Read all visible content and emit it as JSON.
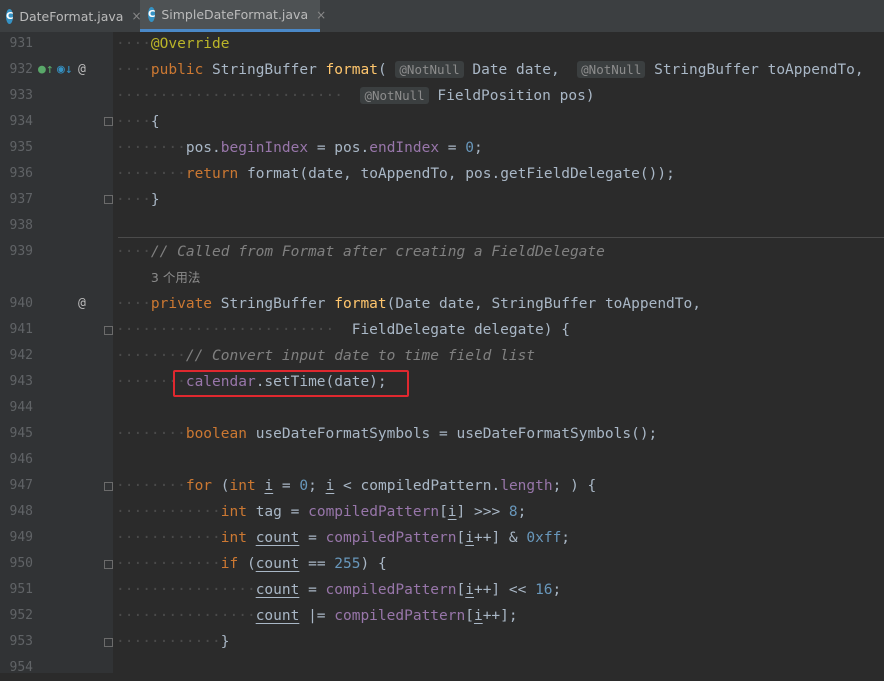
{
  "tabs": [
    {
      "label": "DateFormat.java",
      "active": false
    },
    {
      "label": "SimpleDateFormat.java",
      "active": true
    }
  ],
  "tab_icon_letter": "C",
  "tab_close": "×",
  "gutter_icons": {
    "override_up": "●↑",
    "impl_down": "◉↓",
    "at": "@"
  },
  "hints": {
    "notnull": "@NotNull"
  },
  "usages_label": "3 个用法",
  "lines": {
    "931": "931",
    "932": "932",
    "933": "933",
    "934": "934",
    "935": "935",
    "936": "936",
    "937": "937",
    "938": "938",
    "939": "939",
    "940": "940",
    "941": "941",
    "942": "942",
    "943": "943",
    "944": "944",
    "945": "945",
    "946": "946",
    "947": "947",
    "948": "948",
    "949": "949",
    "950": "950",
    "951": "951",
    "952": "952",
    "953": "953",
    "954": "954"
  },
  "code": {
    "override": "@Override",
    "public": "public",
    "stringbuffer": "StringBuffer",
    "format": "format",
    "date_type": "Date",
    "date": "date",
    "toappendto": "toAppendTo",
    "fieldposition": "FieldPosition",
    "pos": "pos",
    "begin_index": "beginIndex",
    "end_index": "endIndex",
    "zero": "0",
    "ret": "return",
    "get_field_delegate": "getFieldDelegate",
    "comment1": "// Called from Format after creating a FieldDelegate",
    "private": "private",
    "field_delegate": "FieldDelegate",
    "delegate": "delegate",
    "comment2": "// Convert input date to time field list",
    "calendar": "calendar",
    "set_time": ".setTime(date);",
    "boolean": "boolean",
    "use_dfs_var": "useDateFormatSymbols",
    "use_dfs_call": "useDateFormatSymbols();",
    "for": "for",
    "int": "int",
    "i": "i",
    "compiled_pattern": "compiledPattern",
    "length": "length",
    "tag": "tag",
    "shift": "8",
    "count": "count",
    "hex": "0xff",
    "if": "if",
    "num255": "255",
    "sixteen": "16"
  },
  "colors": {
    "highlight_box": "#e0282f",
    "accent": "#4a88c7"
  }
}
